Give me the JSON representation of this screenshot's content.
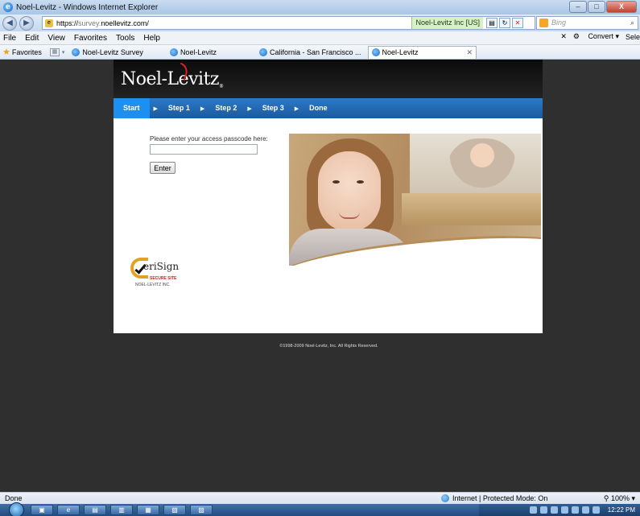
{
  "window": {
    "title": "Noel-Levitz - Windows Internet Explorer",
    "minimize": "–",
    "maximize": "□",
    "close": "X"
  },
  "address": {
    "scheme": "https://",
    "subdomain": "survey.",
    "domain": "noellevitz.com/",
    "certificate": "Noel-Levitz Inc [US]",
    "search_placeholder": "Bing"
  },
  "menu": {
    "items": [
      "File",
      "Edit",
      "View",
      "Favorites",
      "Tools",
      "Help"
    ],
    "convert": "Convert",
    "select": "Sele"
  },
  "favorites": {
    "label": "Favorites",
    "tabs": [
      "Noel-Levitz Survey",
      "Noel-Levitz",
      "California - San Francisco ...",
      "Noel-Levitz"
    ]
  },
  "page": {
    "logo": "Noel-Levitz",
    "logo_mark": "®",
    "steps": [
      "Start",
      "Step 1",
      "Step 2",
      "Step 3",
      "Done"
    ],
    "active_step": "Start",
    "prompt": "Please enter your access passcode here:",
    "passcode_value": "",
    "enter_label": "Enter",
    "verisign_name": "eriSign",
    "verisign_secure": "SECURE SITE",
    "verisign_company": "NOEL-LEVITZ INC.",
    "copyright": "©1998-2009 Noel-Levitz, Inc. All Rights Reserved."
  },
  "status": {
    "left": "Done",
    "zone": "Internet | Protected Mode: On",
    "zoom": "100%"
  },
  "taskbar": {
    "clock": "12:22 PM"
  },
  "colors": {
    "stepbar": "#1a5aa0",
    "active_step": "#1d8ff0",
    "header": "#0b0b0b",
    "background": "#2f2f2f"
  }
}
